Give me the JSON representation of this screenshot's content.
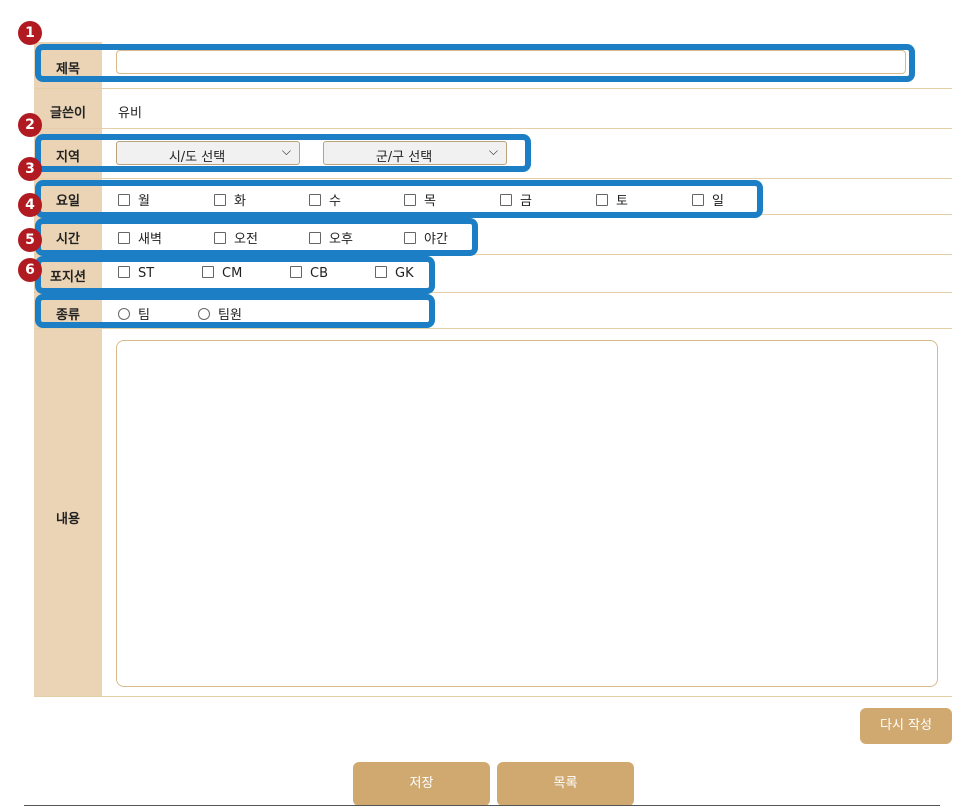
{
  "form": {
    "labels": {
      "title": "제목",
      "author": "글쓴이",
      "region": "지역",
      "day": "요일",
      "time": "시간",
      "position": "포지션",
      "type": "종류",
      "content": "내용"
    },
    "author_value": "유비",
    "title_value": "",
    "region": {
      "sido_selected": "시/도 선택",
      "gugun_selected": "군/구 선택"
    },
    "days": [
      "월",
      "화",
      "수",
      "목",
      "금",
      "토",
      "일"
    ],
    "times": [
      "새벽",
      "오전",
      "오후",
      "야간"
    ],
    "positions": [
      "ST",
      "CM",
      "CB",
      "GK"
    ],
    "types": [
      "팀",
      "팀원"
    ],
    "content_value": ""
  },
  "buttons": {
    "rewrite": "다시 작성",
    "save": "저장",
    "list": "목록"
  },
  "annotations": [
    "1",
    "2",
    "3",
    "4",
    "5",
    "6"
  ],
  "colors": {
    "label_bg": "#ead4b5",
    "button_bg": "#d0a971",
    "annotation_border": "#1c7ec4",
    "badge_bg": "#b01a20"
  }
}
